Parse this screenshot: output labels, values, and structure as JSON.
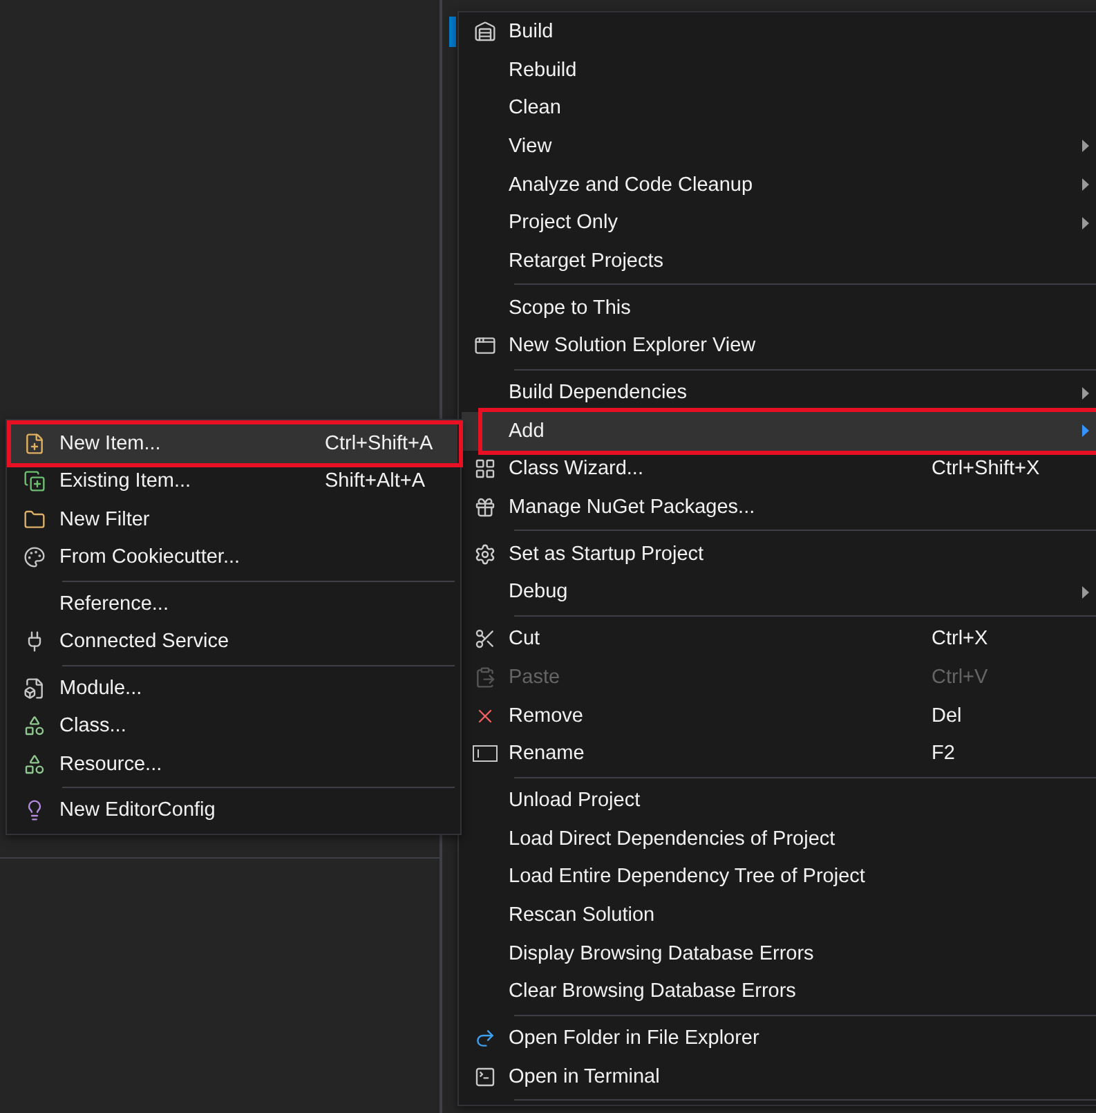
{
  "context_menu": {
    "items": [
      {
        "kind": "item",
        "label": "Build",
        "has_submenu": false,
        "highlighted": false,
        "disabled": false
      },
      {
        "kind": "item",
        "label": "Rebuild",
        "has_submenu": false,
        "highlighted": false,
        "disabled": false
      },
      {
        "kind": "item",
        "label": "Clean",
        "has_submenu": false,
        "highlighted": false,
        "disabled": false
      },
      {
        "kind": "item",
        "label": "View",
        "has_submenu": true,
        "highlighted": false,
        "disabled": false
      },
      {
        "kind": "item",
        "label": "Analyze and Code Cleanup",
        "has_submenu": true,
        "highlighted": false,
        "disabled": false
      },
      {
        "kind": "item",
        "label": "Project Only",
        "has_submenu": true,
        "highlighted": false,
        "disabled": false
      },
      {
        "kind": "item",
        "label": "Retarget Projects",
        "has_submenu": false,
        "highlighted": false,
        "disabled": false
      },
      {
        "kind": "separator"
      },
      {
        "kind": "item",
        "label": "Scope to This",
        "has_submenu": false,
        "highlighted": false,
        "disabled": false
      },
      {
        "kind": "item",
        "label": "New Solution Explorer View",
        "has_submenu": false,
        "highlighted": false,
        "disabled": false
      },
      {
        "kind": "separator"
      },
      {
        "kind": "item",
        "label": "Build Dependencies",
        "has_submenu": true,
        "highlighted": false,
        "disabled": false
      },
      {
        "kind": "item",
        "label": "Add",
        "has_submenu": true,
        "highlighted": true,
        "disabled": false
      },
      {
        "kind": "item",
        "label": "Class Wizard...",
        "shortcut": "Ctrl+Shift+X",
        "has_submenu": false,
        "highlighted": false,
        "disabled": false
      },
      {
        "kind": "item",
        "label": "Manage NuGet Packages...",
        "has_submenu": false,
        "highlighted": false,
        "disabled": false
      },
      {
        "kind": "separator"
      },
      {
        "kind": "item",
        "label": "Set as Startup Project",
        "has_submenu": false,
        "highlighted": false,
        "disabled": false
      },
      {
        "kind": "item",
        "label": "Debug",
        "has_submenu": true,
        "highlighted": false,
        "disabled": false
      },
      {
        "kind": "separator"
      },
      {
        "kind": "item",
        "label": "Cut",
        "shortcut": "Ctrl+X",
        "has_submenu": false,
        "highlighted": false,
        "disabled": false
      },
      {
        "kind": "item",
        "label": "Paste",
        "shortcut": "Ctrl+V",
        "has_submenu": false,
        "highlighted": false,
        "disabled": true
      },
      {
        "kind": "item",
        "label": "Remove",
        "shortcut": "Del",
        "has_submenu": false,
        "highlighted": false,
        "disabled": false
      },
      {
        "kind": "item",
        "label": "Rename",
        "shortcut": "F2",
        "has_submenu": false,
        "highlighted": false,
        "disabled": false
      },
      {
        "kind": "separator"
      },
      {
        "kind": "item",
        "label": "Unload Project",
        "has_submenu": false,
        "highlighted": false,
        "disabled": false
      },
      {
        "kind": "item",
        "label": "Load Direct Dependencies of Project",
        "has_submenu": false,
        "highlighted": false,
        "disabled": false
      },
      {
        "kind": "item",
        "label": "Load Entire Dependency Tree of Project",
        "has_submenu": false,
        "highlighted": false,
        "disabled": false
      },
      {
        "kind": "item",
        "label": "Rescan Solution",
        "has_submenu": false,
        "highlighted": false,
        "disabled": false
      },
      {
        "kind": "item",
        "label": "Display Browsing Database Errors",
        "has_submenu": false,
        "highlighted": false,
        "disabled": false
      },
      {
        "kind": "item",
        "label": "Clear Browsing Database Errors",
        "has_submenu": false,
        "highlighted": false,
        "disabled": false
      },
      {
        "kind": "separator"
      },
      {
        "kind": "item",
        "label": "Open Folder in File Explorer",
        "has_submenu": false,
        "highlighted": false,
        "disabled": false
      },
      {
        "kind": "item",
        "label": "Open in Terminal",
        "has_submenu": false,
        "highlighted": false,
        "disabled": false
      },
      {
        "kind": "separator"
      }
    ]
  },
  "add_submenu": {
    "items": [
      {
        "kind": "item",
        "label": "New Item...",
        "shortcut": "Ctrl+Shift+A",
        "highlighted": true
      },
      {
        "kind": "item",
        "label": "Existing Item...",
        "shortcut": "Shift+Alt+A",
        "highlighted": false
      },
      {
        "kind": "item",
        "label": "New Filter",
        "highlighted": false
      },
      {
        "kind": "item",
        "label": "From Cookiecutter...",
        "highlighted": false
      },
      {
        "kind": "separator"
      },
      {
        "kind": "item",
        "label": "Reference...",
        "highlighted": false
      },
      {
        "kind": "item",
        "label": "Connected Service",
        "highlighted": false
      },
      {
        "kind": "separator"
      },
      {
        "kind": "item",
        "label": "Module...",
        "highlighted": false
      },
      {
        "kind": "item",
        "label": "Class...",
        "highlighted": false
      },
      {
        "kind": "item",
        "label": "Resource...",
        "highlighted": false
      },
      {
        "kind": "separator"
      },
      {
        "kind": "item",
        "label": "New EditorConfig",
        "highlighted": false
      }
    ]
  }
}
